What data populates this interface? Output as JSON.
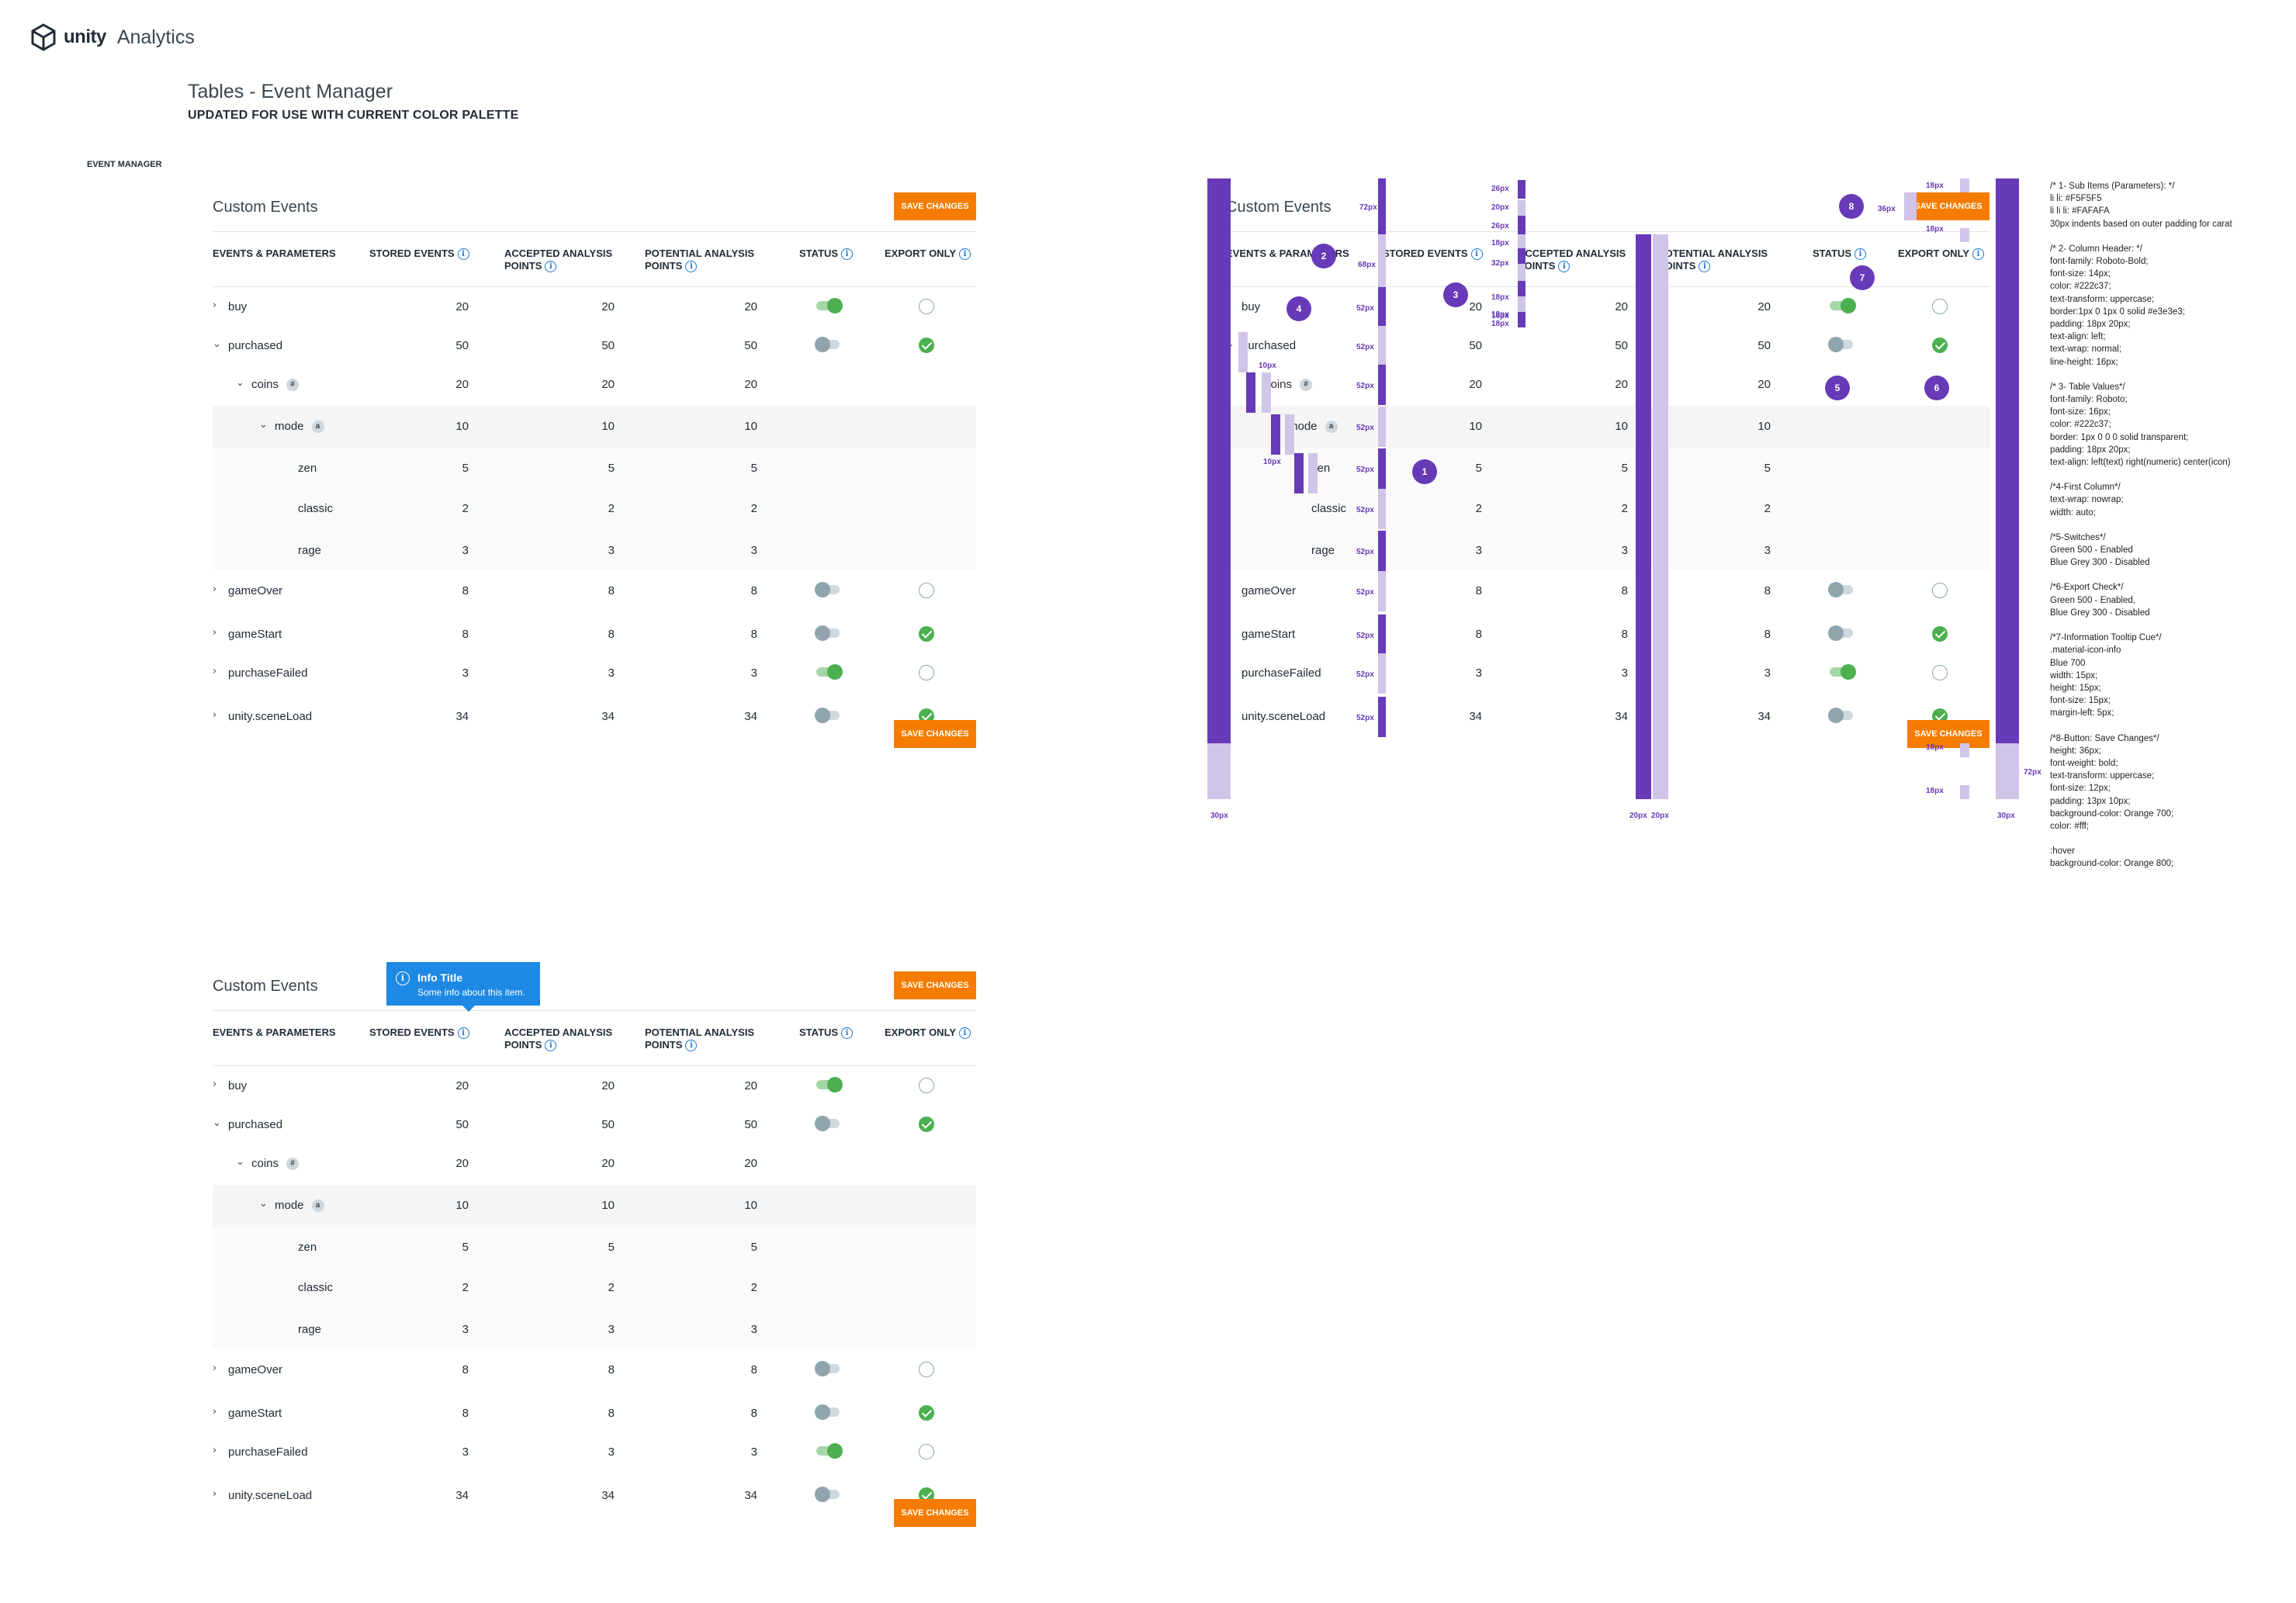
{
  "brand": {
    "word": "unity",
    "product": "Analytics"
  },
  "page": {
    "title": "Tables - Event Manager",
    "subtitle": "UPDATED FOR USE WITH CURRENT COLOR PALETTE",
    "section_label": "EVENT MANAGER"
  },
  "panel": {
    "title": "Custom Events",
    "save_label": "SAVE CHANGES",
    "columns": {
      "events": "EVENTS & PARAMETERS",
      "stored": "STORED EVENTS",
      "accepted_1": "ACCEPTED ANALYSIS",
      "accepted_2": "POINTS",
      "potential_1": "POTENTIAL ANALYSIS",
      "potential_2": "POINTS",
      "status": "STATUS",
      "export": "EXPORT ONLY"
    },
    "rows": [
      {
        "name": "buy",
        "level": 0,
        "chevron": "right",
        "stored": "20",
        "accepted": "20",
        "potential": "20",
        "status": "on",
        "export": "empty"
      },
      {
        "name": "purchased",
        "level": 0,
        "chevron": "down",
        "stored": "50",
        "accepted": "50",
        "potential": "50",
        "status": "off",
        "export": "checked"
      },
      {
        "name": "coins",
        "level": 1,
        "chevron": "down",
        "badge": "#",
        "stored": "20",
        "accepted": "20",
        "potential": "20"
      },
      {
        "name": "mode",
        "level": 2,
        "chevron": "down",
        "badge": "a",
        "stored": "10",
        "accepted": "10",
        "potential": "10"
      },
      {
        "name": "zen",
        "level": 3,
        "stored": "5",
        "accepted": "5",
        "potential": "5"
      },
      {
        "name": "classic",
        "level": 3,
        "stored": "2",
        "accepted": "2",
        "potential": "2"
      },
      {
        "name": "rage",
        "level": 3,
        "stored": "3",
        "accepted": "3",
        "potential": "3"
      },
      {
        "name": "gameOver",
        "level": 0,
        "chevron": "right",
        "stored": "8",
        "accepted": "8",
        "potential": "8",
        "status": "off",
        "export": "empty"
      },
      {
        "name": "gameStart",
        "level": 0,
        "chevron": "right",
        "stored": "8",
        "accepted": "8",
        "potential": "8",
        "status": "off",
        "export": "checked"
      },
      {
        "name": "purchaseFailed",
        "level": 0,
        "chevron": "right",
        "stored": "3",
        "accepted": "3",
        "potential": "3",
        "status": "on",
        "export": "empty"
      },
      {
        "name": "unity.sceneLoad",
        "level": 0,
        "chevron": "right",
        "stored": "34",
        "accepted": "34",
        "potential": "34",
        "status": "off",
        "export": "checked"
      }
    ]
  },
  "tooltip": {
    "title": "Info Title",
    "body": "Some info about this item."
  },
  "redline": {
    "dims": {
      "px72": "72px",
      "px68": "68px",
      "px52": "52px",
      "px30": "30px",
      "px20": "20px",
      "px10": "10px",
      "px26": "26px",
      "px18": "18px",
      "px32": "32px",
      "px16": "16px",
      "px36": "36px"
    },
    "markers": [
      "1",
      "2",
      "3",
      "4",
      "5",
      "6",
      "7",
      "8"
    ]
  },
  "notes": [
    "/* 1- Sub Items (Parameters): */",
    "li li: #F5F5F5",
    "li li li: #FAFAFA",
    "30px indents based on outer padding for carat",
    "",
    "/* 2- Column Header: */",
    "font-family: Roboto-Bold;",
    "font-size: 14px;",
    "color: #222c37;",
    "text-transform: uppercase;",
    "border:1px 0 1px 0 solid #e3e3e3;",
    "padding: 18px 20px;",
    "text-align: left;",
    "text-wrap: normal;",
    "line-height: 16px;",
    "",
    "/* 3- Table Values*/",
    "font-family: Roboto;",
    "font-size: 16px;",
    "color: #222c37;",
    "border: 1px 0 0 0 solid transparent;",
    "padding: 18px 20px;",
    "text-align: left(text) right(numeric) center(icon)",
    "",
    "/*4-First Column*/",
    "text-wrap: nowrap;",
    "width: auto;",
    "",
    "/*5-Switches*/",
    "Green 500 - Enabled",
    "Blue Grey 300 - Disabled",
    "",
    "/*6-Export Check*/",
    "Green 500 - Enabled,",
    "Blue Grey 300 - Disabled",
    "",
    "/*7-Information Tooltip Cue*/",
    ".material-icon-info",
    "Blue 700",
    "width: 15px;",
    "height: 15px;",
    "font-size: 15px;",
    "margin-left: 5px;",
    "",
    "/*8-Button: Save Changes*/",
    "height: 36px;",
    "font-weight: bold;",
    "text-transform: uppercase;",
    "font-size: 12px;",
    "padding: 13px 10px;",
    "background-color: Orange 700;",
    "color: #fff;",
    "",
    ":hover",
    "background-color: Orange 800;"
  ]
}
